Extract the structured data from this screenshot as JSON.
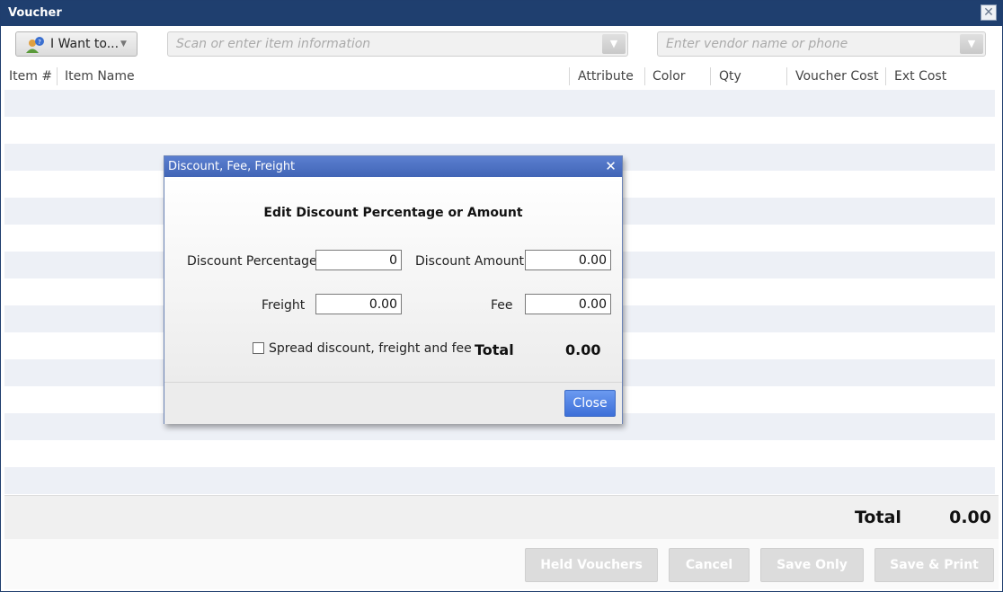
{
  "window": {
    "title": "Voucher"
  },
  "toolbar": {
    "iwant_label": "I Want to...",
    "item_search_placeholder": "Scan or enter item information",
    "vendor_search_placeholder": "Enter vendor name or phone"
  },
  "table": {
    "columns": [
      "Item #",
      "Item Name",
      "Attribute",
      "Color",
      "Qty",
      "Voucher Cost",
      "Ext Cost"
    ]
  },
  "totals": {
    "label": "Total",
    "value": "0.00"
  },
  "footer": {
    "held_vouchers": "Held Vouchers",
    "cancel": "Cancel",
    "save_only": "Save Only",
    "save_print": "Save & Print"
  },
  "dialog": {
    "title": "Discount, Fee, Freight",
    "heading": "Edit Discount Percentage or Amount",
    "discount_percentage_label": "Discount Percentage",
    "discount_percentage_value": "0",
    "discount_amount_label": "Discount Amount",
    "discount_amount_value": "0.00",
    "freight_label": "Freight",
    "freight_value": "0.00",
    "fee_label": "Fee",
    "fee_value": "0.00",
    "spread_label": "Spread discount, freight and fee",
    "total_label": "Total",
    "total_value": "0.00",
    "close_label": "Close"
  },
  "colors": {
    "titlebar": "#1f3f6f",
    "dialog_titlebar": "#4a70c4",
    "row_stripe": "#edf0f6",
    "close_button": "#4a7ee0"
  }
}
